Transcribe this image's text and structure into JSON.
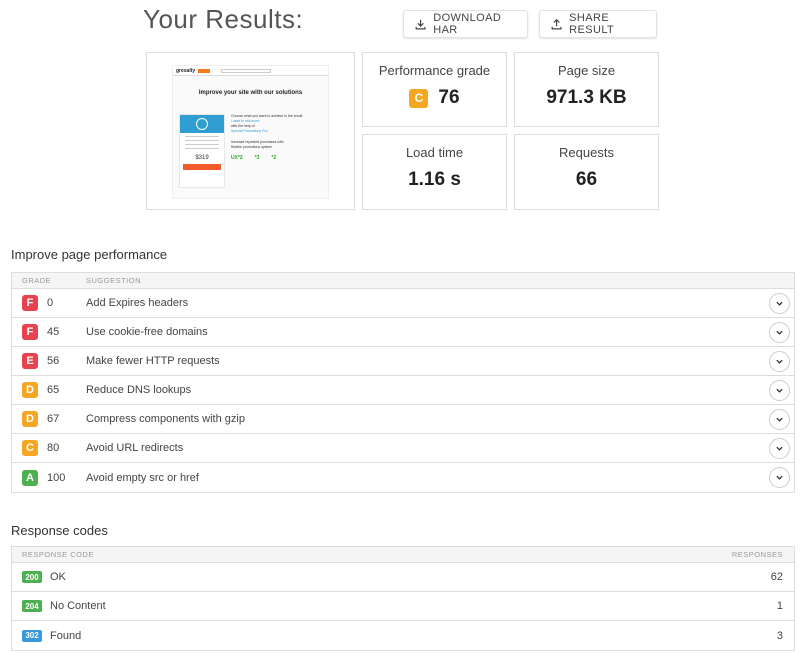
{
  "header": {
    "title": "Your Results:",
    "download_har": "DOWNLOAD HAR",
    "share_result": "SHARE RESULT"
  },
  "screenshot": {
    "headline": "Improve your site with our solutions",
    "logo": "grexalty",
    "price": "$319",
    "text_lines": [
      "Choose what you want to achieve in the result",
      "I want to sell more",
      "with the help of",
      "Special Promotions Pro",
      "Increase repeated purchases with",
      "flexible promotions system"
    ],
    "stats": [
      "UX*2",
      "*3",
      "*2"
    ]
  },
  "metrics": {
    "performance_grade": {
      "label": "Performance grade",
      "grade": "C",
      "value": "76",
      "color": "#f5a623"
    },
    "page_size": {
      "label": "Page size",
      "value": "971.3 KB"
    },
    "load_time": {
      "label": "Load time",
      "value": "1.16 s"
    },
    "requests": {
      "label": "Requests",
      "value": "66"
    }
  },
  "performance": {
    "title": "Improve page performance",
    "columns": [
      "GRADE",
      "SUGGESTION"
    ],
    "rows": [
      {
        "grade": "F",
        "score": "0",
        "suggestion": "Add Expires headers",
        "color": "#e8424f"
      },
      {
        "grade": "F",
        "score": "45",
        "suggestion": "Use cookie-free domains",
        "color": "#e8424f"
      },
      {
        "grade": "E",
        "score": "56",
        "suggestion": "Make fewer HTTP requests",
        "color": "#e8424f"
      },
      {
        "grade": "D",
        "score": "65",
        "suggestion": "Reduce DNS lookups",
        "color": "#f5a623"
      },
      {
        "grade": "D",
        "score": "67",
        "suggestion": "Compress components with gzip",
        "color": "#f5a623"
      },
      {
        "grade": "C",
        "score": "80",
        "suggestion": "Avoid URL redirects",
        "color": "#f5a623"
      },
      {
        "grade": "A",
        "score": "100",
        "suggestion": "Avoid empty src or href",
        "color": "#4caf50"
      }
    ]
  },
  "responses": {
    "title": "Response codes",
    "columns": [
      "RESPONSE CODE",
      "RESPONSES"
    ],
    "rows": [
      {
        "code": "200",
        "label": "OK",
        "count": "62",
        "color": "#4caf50"
      },
      {
        "code": "204",
        "label": "No Content",
        "count": "1",
        "color": "#4caf50"
      },
      {
        "code": "302",
        "label": "Found",
        "count": "3",
        "color": "#3a9ad9"
      }
    ]
  }
}
